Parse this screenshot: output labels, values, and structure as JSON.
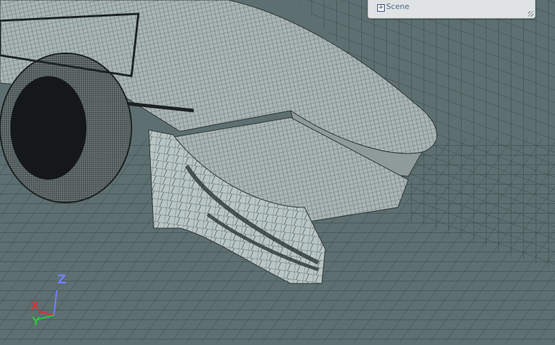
{
  "scene_panel": {
    "label": "Scene",
    "toggle_symbol": "+"
  },
  "axes": {
    "x_label": "X",
    "y_label": "Y",
    "z_label": "Z",
    "x_color": "#e03030",
    "y_color": "#30c040",
    "z_color": "#7080ff"
  },
  "colors": {
    "background": "#5e6f71",
    "mesh_surface": "#b9c4c4",
    "mesh_dark": "#2b3334"
  }
}
